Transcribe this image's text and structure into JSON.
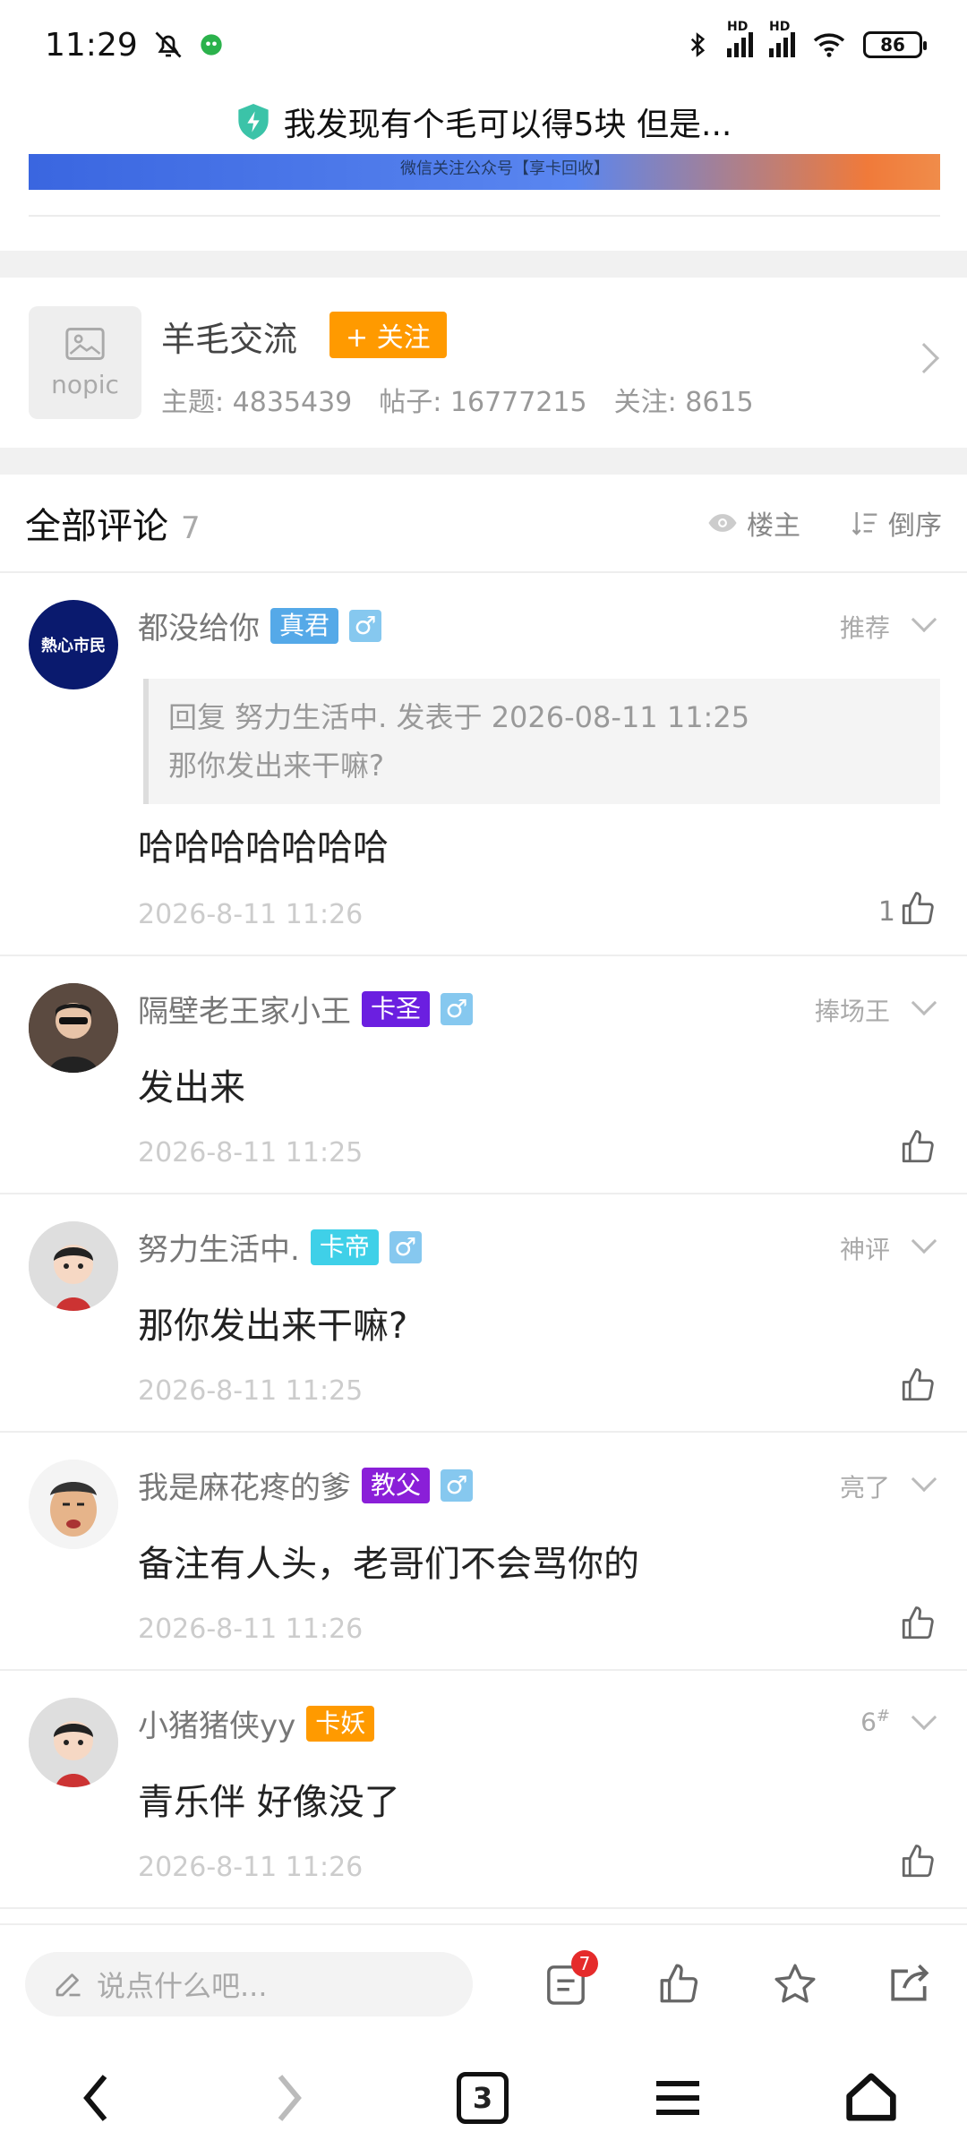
{
  "status_bar": {
    "time": "11:29",
    "battery": "86",
    "hd1": "HD",
    "hd2": "HD"
  },
  "title": "我发现有个毛可以得5块 但是...",
  "banner_text": "微信关注公众号【享卡回收】",
  "forum": {
    "nopic_label": "nopic",
    "name": "羊毛交流",
    "follow_label": "+ 关注",
    "stats": {
      "topics": "主题: 4835439",
      "posts": "帖子: 16777215",
      "followers": "关注: 8615"
    }
  },
  "comments_header": {
    "title": "全部评论",
    "count": "7",
    "owner_only": "楼主",
    "reverse": "倒序"
  },
  "comments": [
    {
      "user": "都没给你",
      "badge": "真君",
      "badge_color": "#55a9e8",
      "gender": "♂",
      "tag": "推荐",
      "avatar_text": "熱心市民",
      "quote_line1": "回复 努力生活中. 发表于 2026-08-11 11:25",
      "quote_line2": "那你发出来干嘛?",
      "text": "哈哈哈哈哈哈哈",
      "time": "2026-8-11 11:26",
      "likes": "1"
    },
    {
      "user": "隔壁老王家小王",
      "badge": "卡圣",
      "badge_color": "#6b1fe0",
      "gender": "♂",
      "tag": "捧场王",
      "text": "发出来",
      "time": "2026-8-11 11:25",
      "likes": ""
    },
    {
      "user": "努力生活中.",
      "badge": "卡帝",
      "badge_color": "#3fd0e8",
      "gender": "♂",
      "tag": "神评",
      "text": "那你发出来干嘛?",
      "time": "2026-8-11 11:25",
      "likes": ""
    },
    {
      "user": "我是麻花疼的爹",
      "badge": "教父",
      "badge_color": "#8a1fd8",
      "gender": "♂",
      "tag": "亮了",
      "text": "备注有人头，老哥们不会骂你的",
      "time": "2026-8-11 11:26",
      "likes": ""
    },
    {
      "user": "小猪猪侠yy",
      "badge": "卡妖",
      "badge_color": "#ff9a00",
      "gender": "",
      "tag": "6",
      "tag_sup": "#",
      "text": "青乐伴 好像没了",
      "time": "2026-8-11 11:26",
      "likes": ""
    }
  ],
  "bottom_bar": {
    "placeholder": "说点什么吧...",
    "comment_badge": "7"
  },
  "nav": {
    "tabs_count": "3"
  }
}
